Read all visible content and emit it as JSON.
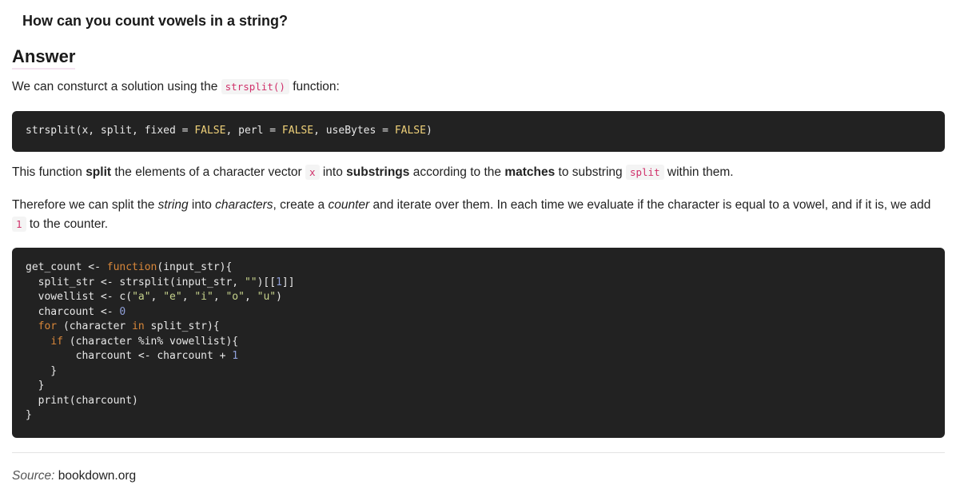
{
  "question": "How can you count vowels in a string?",
  "answer_heading": "Answer",
  "intro": {
    "before": "We can consturct a solution using the ",
    "code": "strsplit()",
    "after": " function:"
  },
  "signature_code": {
    "parts": [
      {
        "t": "strsplit(x, split, fixed = ",
        "c": ""
      },
      {
        "t": "FALSE",
        "c": "lit"
      },
      {
        "t": ", perl = ",
        "c": ""
      },
      {
        "t": "FALSE",
        "c": "lit"
      },
      {
        "t": ", useBytes = ",
        "c": ""
      },
      {
        "t": "FALSE",
        "c": "lit"
      },
      {
        "t": ")",
        "c": ""
      }
    ]
  },
  "explanation": {
    "s1": "This function ",
    "b1": "split",
    "s2": " the elements of a character vector ",
    "code1": "x",
    "s3": " into ",
    "b2": "substrings",
    "s4": " according to the ",
    "b3": "matches",
    "s5": " to substring ",
    "code2": "split",
    "s6": " within them."
  },
  "approach": {
    "s1": "Therefore we can split the ",
    "i1": "string",
    "s2": " into ",
    "i2": "characters",
    "s3": ", create a ",
    "i3": "counter",
    "s4": " and iterate over them. In each time we evaluate if the character is equal to a vowel, and if it is, we add ",
    "code1": "1",
    "s5": " to the counter."
  },
  "function_code": {
    "lines": [
      [
        {
          "t": "get_count <- ",
          "c": ""
        },
        {
          "t": "function",
          "c": "kw"
        },
        {
          "t": "(input_str){",
          "c": ""
        }
      ],
      [
        {
          "t": "  split_str <- strsplit(input_str, ",
          "c": ""
        },
        {
          "t": "\"\"",
          "c": "str"
        },
        {
          "t": ")[[",
          "c": ""
        },
        {
          "t": "1",
          "c": "num"
        },
        {
          "t": "]]",
          "c": ""
        }
      ],
      [
        {
          "t": "  vowellist <- c(",
          "c": ""
        },
        {
          "t": "\"a\"",
          "c": "str"
        },
        {
          "t": ", ",
          "c": ""
        },
        {
          "t": "\"e\"",
          "c": "str"
        },
        {
          "t": ", ",
          "c": ""
        },
        {
          "t": "\"i\"",
          "c": "str"
        },
        {
          "t": ", ",
          "c": ""
        },
        {
          "t": "\"o\"",
          "c": "str"
        },
        {
          "t": ", ",
          "c": ""
        },
        {
          "t": "\"u\"",
          "c": "str"
        },
        {
          "t": ")",
          "c": ""
        }
      ],
      [
        {
          "t": "  charcount <- ",
          "c": ""
        },
        {
          "t": "0",
          "c": "num"
        }
      ],
      [
        {
          "t": "  ",
          "c": ""
        },
        {
          "t": "for",
          "c": "kw"
        },
        {
          "t": " (character ",
          "c": ""
        },
        {
          "t": "in",
          "c": "kw"
        },
        {
          "t": " split_str){",
          "c": ""
        }
      ],
      [
        {
          "t": "    ",
          "c": ""
        },
        {
          "t": "if",
          "c": "kw"
        },
        {
          "t": " (character %in% vowellist){",
          "c": ""
        }
      ],
      [
        {
          "t": "        charcount <- charcount + ",
          "c": ""
        },
        {
          "t": "1",
          "c": "num"
        }
      ],
      [
        {
          "t": "    }",
          "c": ""
        }
      ],
      [
        {
          "t": "  }",
          "c": ""
        }
      ],
      [
        {
          "t": "  print(charcount)",
          "c": ""
        }
      ],
      [
        {
          "t": "}",
          "c": ""
        }
      ]
    ]
  },
  "source": {
    "label": "Source:",
    "link": "bookdown.org"
  }
}
